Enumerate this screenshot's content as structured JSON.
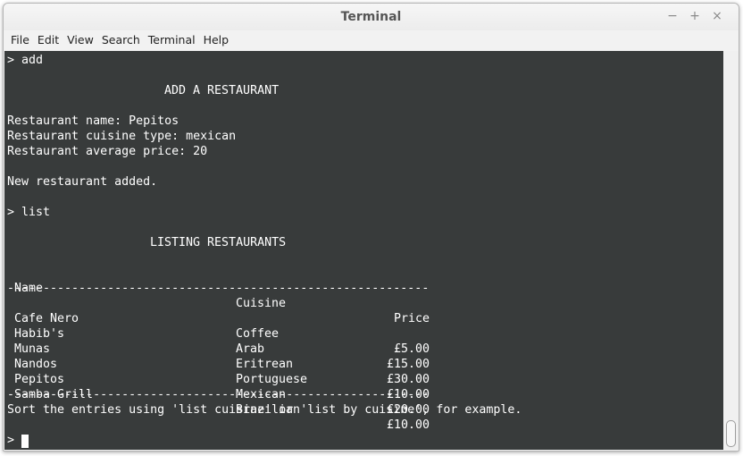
{
  "window": {
    "title": "Terminal",
    "controls": {
      "minimize": "−",
      "maximize": "+",
      "close": "×"
    }
  },
  "menu": [
    "File",
    "Edit",
    "View",
    "Search",
    "Terminal",
    "Help"
  ],
  "terminal": {
    "cmd_add": "> add",
    "add_heading": "ADD A RESTAURANT",
    "name_line": "Restaurant name: Pepitos",
    "cuisine_line": "Restaurant cuisine type: mexican",
    "price_line": "Restaurant average price: 20",
    "added_msg": "New restaurant added.",
    "cmd_list": "> list",
    "list_heading": "LISTING RESTAURANTS",
    "table": {
      "headers": {
        "name": "Name",
        "cuisine": "Cuisine",
        "price": "Price"
      },
      "separator": "-----------------------------------------------------------",
      "rows": [
        {
          "name": "Cafe Nero",
          "cuisine": "Coffee",
          "price": "£5.00"
        },
        {
          "name": "Habib's",
          "cuisine": "Arab",
          "price": "£15.00"
        },
        {
          "name": "Munas",
          "cuisine": "Eritrean",
          "price": "£30.00"
        },
        {
          "name": "Nandos",
          "cuisine": "Portuguese",
          "price": "£10.00"
        },
        {
          "name": "Pepitos",
          "cuisine": "Mexican",
          "price": "£20.00"
        },
        {
          "name": "Samba Grill",
          "cuisine": "Brazilian",
          "price": "£10.00"
        }
      ]
    },
    "hint": "Sort the entries using 'list cuisine' or 'list by cuisine', for example.",
    "prompt": ">"
  }
}
